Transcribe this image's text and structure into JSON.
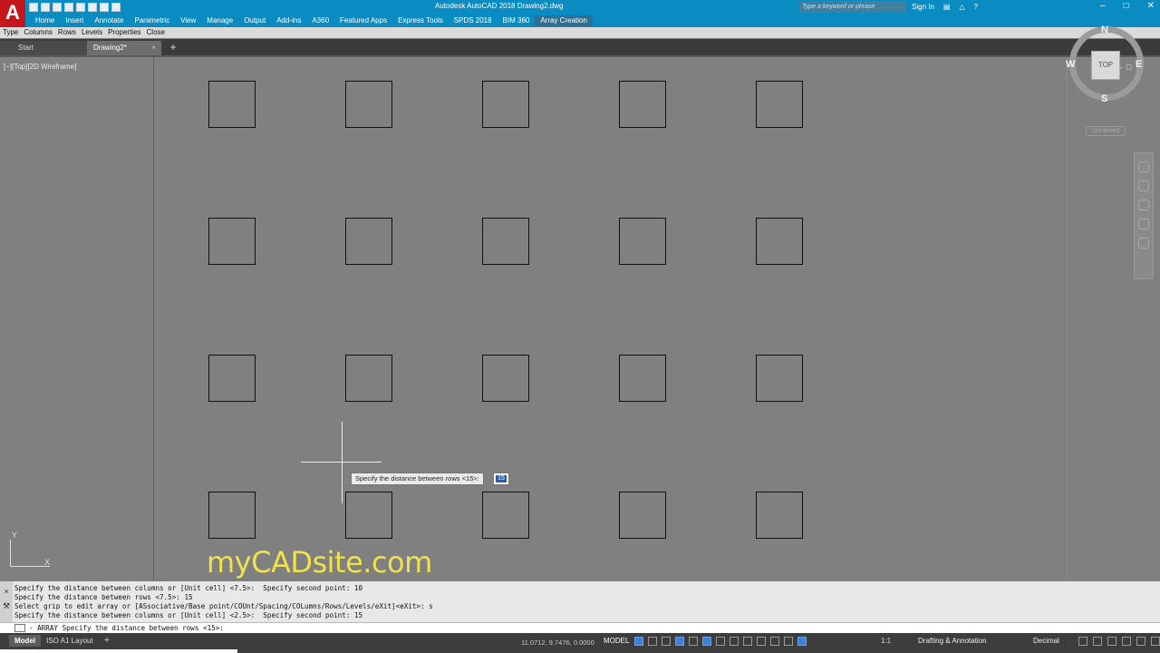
{
  "app": {
    "logo": "A",
    "title": "Autodesk AutoCAD 2018   Drawing2.dwg",
    "search_placeholder": "Type a keyword or phrase",
    "sign_in": "Sign In",
    "ribbon_tabs": [
      "Home",
      "Insert",
      "Annotate",
      "Parametric",
      "View",
      "Manage",
      "Output",
      "Add-ins",
      "A360",
      "Featured Apps",
      "Express Tools",
      "SPDS 2018",
      "BIM 360",
      "Array Creation"
    ],
    "active_ribbon_tab": "Array Creation",
    "contextual_panels": [
      "Type",
      "Columns",
      "Rows",
      "Levels",
      "Properties",
      "Close"
    ]
  },
  "file_tabs": {
    "start": "Start",
    "drawing": "Drawing2*",
    "close_glyph": "×",
    "add_glyph": "+"
  },
  "viewport": {
    "label": "[−][Top][2D Wireframe]",
    "controls": [
      "–",
      "□",
      "×"
    ],
    "ucs_x": "X",
    "ucs_y": "Y"
  },
  "array": {
    "rows": 4,
    "columns": 5,
    "column_spacing": 10,
    "row_spacing": 15
  },
  "viewcube": {
    "north": "N",
    "south": "S",
    "east": "E",
    "west": "W",
    "face": "TOP",
    "wcs": "Unnamed"
  },
  "prompt": {
    "tooltip": "Specify the distance between rows <15>:",
    "input_value": "15"
  },
  "watermark": "myCADsite.com",
  "command_history": [
    "Specify the distance between columns or [Unit cell] <7.5>:  Specify second point: 10",
    "Specify the distance between rows <7.5>: 15",
    "Select grip to edit array or [ASsociative/Base point/COUnt/Spacing/COLumns/Rows/Levels/eXit]<eXit>: s",
    "Specify the distance between columns or [Unit cell] <2.5>:  Specify second point: 15"
  ],
  "command_line": "- ARRAY Specify the distance between rows <15>:",
  "status": {
    "layout_tabs": [
      "Model",
      "ISO A1 Layout"
    ],
    "active_layout": "Model",
    "add_layout": "+",
    "coordinates": "11.0712, 9.7476, 0.0000",
    "model": "MODEL",
    "annotation_scale": "1:1",
    "workspace": "Drafting & Annotation",
    "units": "Decimal"
  }
}
